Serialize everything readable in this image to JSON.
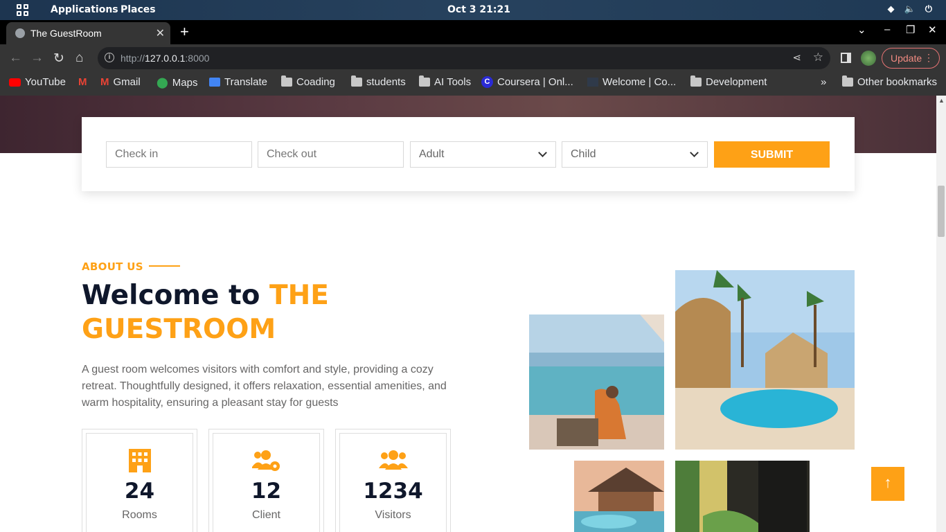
{
  "topbar": {
    "applications": "Applications",
    "places": "Places",
    "clock": "Oct 3  21:21"
  },
  "browser": {
    "tab_title": "The GuestRoom",
    "url_prefix": "http://",
    "url_host": "127.0.0.1",
    "url_port": ":8000",
    "update_label": "Update"
  },
  "bookmarks": [
    "YouTube",
    "Gmail",
    "Maps",
    "Translate",
    "Coading",
    "students",
    "AI Tools",
    "Coursera | Onl...",
    "Welcome | Co...",
    "Development",
    "Other bookmarks"
  ],
  "booking": {
    "checkin_placeholder": "Check in",
    "checkout_placeholder": "Check out",
    "adult_label": "Adult",
    "child_label": "Child",
    "submit_label": "SUBMIT"
  },
  "about": {
    "eyebrow": "ABOUT US",
    "heading_plain": "Welcome to ",
    "heading_accent": "THE GUESTROOM",
    "description": "A guest room welcomes visitors with comfort and style, providing a cozy retreat. Thoughtfully designed, it offers relaxation, essential amenities, and warm hospitality, ensuring a pleasant stay for guests",
    "stats": [
      {
        "number": "24",
        "label": "Rooms",
        "icon": "hotel-icon"
      },
      {
        "number": "12",
        "label": "Client",
        "icon": "users-cog-icon"
      },
      {
        "number": "1234",
        "label": "Visitors",
        "icon": "users-icon"
      }
    ]
  },
  "colors": {
    "accent": "#fea116",
    "dark": "#0f172b",
    "text": "#666565"
  }
}
